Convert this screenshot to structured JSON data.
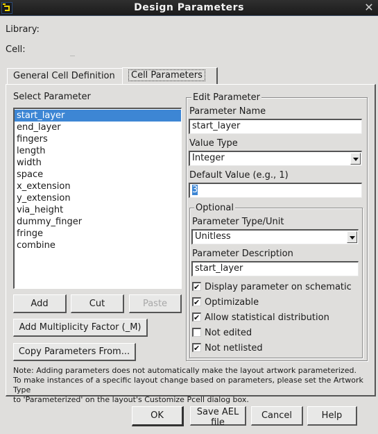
{
  "window": {
    "title": "Design Parameters",
    "app_icon": "ads-logo-icon",
    "close_icon": "close-icon"
  },
  "info": {
    "library_label": "Library:",
    "library_value": "",
    "cell_label": "Cell:",
    "cell_value": "_"
  },
  "tabs": [
    {
      "label": "General Cell Definition",
      "active": false
    },
    {
      "label": "Cell Parameters",
      "active": true
    }
  ],
  "select_parameter": {
    "heading": "Select Parameter",
    "items": [
      "start_layer",
      "end_layer",
      "fingers",
      "length",
      "width",
      "space",
      "x_extension",
      "y_extension",
      "via_height",
      "dummy_finger",
      "fringe",
      "combine"
    ],
    "selected_index": 0
  },
  "list_buttons": {
    "add": "Add",
    "cut": "Cut",
    "paste": "Paste",
    "add_multiplicity": "Add Multiplicity Factor (_M)",
    "copy_params": "Copy Parameters From..."
  },
  "edit_parameter": {
    "legend": "Edit Parameter",
    "name_label": "Parameter Name",
    "name_value": "start_layer",
    "value_type_label": "Value Type",
    "value_type_value": "Integer",
    "default_label": "Default Value (e.g., 1)",
    "default_value": "3",
    "optional": {
      "legend": "Optional",
      "type_unit_label": "Parameter Type/Unit",
      "type_unit_value": "Unitless",
      "description_label": "Parameter Description",
      "description_value": "start_layer",
      "checkboxes": [
        {
          "label": "Display parameter on schematic",
          "checked": true
        },
        {
          "label": "Optimizable",
          "checked": true
        },
        {
          "label": "Allow statistical distribution",
          "checked": true
        },
        {
          "label": "Not edited",
          "checked": false
        },
        {
          "label": "Not netlisted",
          "checked": true
        }
      ]
    }
  },
  "note": {
    "line1": "Note: Adding parameters does not automatically make the layout artwork parameterized.",
    "line2": "To make instances of a specific layout change based on parameters, please set the Artwork Type",
    "line3": "to 'Parameterized' on the layout's Customize Pcell dialog box."
  },
  "footer": {
    "ok": "OK",
    "save_ael": "Save AEL file",
    "cancel": "Cancel",
    "help": "Help"
  }
}
